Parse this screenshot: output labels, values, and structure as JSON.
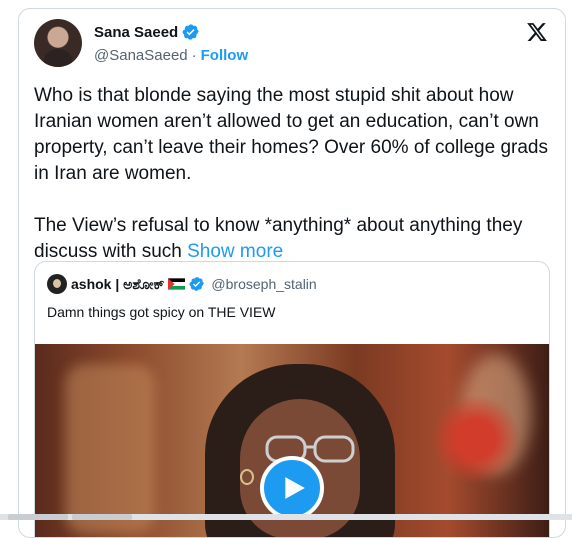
{
  "author": {
    "name": "Sana Saeed",
    "handle": "@SanaSaeed",
    "separator": "·",
    "follow_label": "Follow",
    "verified_color": "#1d9bf0"
  },
  "icons": {
    "brand": "x-logo-icon",
    "verified": "verified-badge-icon",
    "play": "play-icon"
  },
  "tweet": {
    "paragraph1": "Who is that blonde saying the most stupid shit about how Iranian women aren’t allowed to get an education, can’t own property, can’t leave their homes? Over 60% of college grads in Iran are women.",
    "paragraph2": "The View’s refusal to know *anything* about anything they discuss with such",
    "show_more": "Show more"
  },
  "quote": {
    "name": "ashok | ಅಶೋಕ್",
    "flag": "palestine-flag",
    "handle": "@broseph_stalin",
    "text": "Damn things got spicy on THE VIEW"
  },
  "colors": {
    "accent": "#1d9bf0",
    "text": "#0f1419",
    "secondary": "#536471",
    "border": "#cfd9de"
  }
}
